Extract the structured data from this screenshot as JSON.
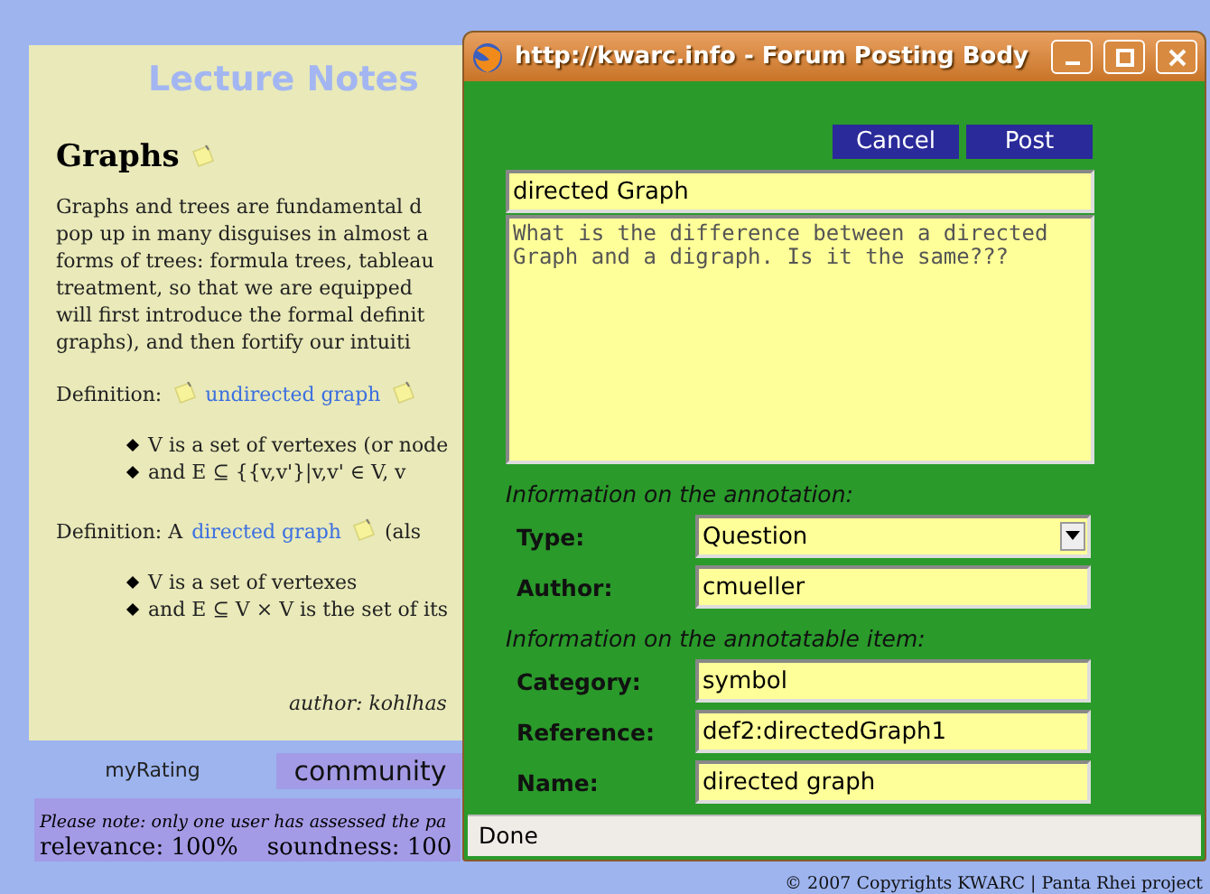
{
  "lecture": {
    "heading": "Lecture Notes",
    "section_title": "Graphs",
    "paragraph_lines": [
      "Graphs and trees are fundamental d",
      "pop up in many disguises in almost a",
      "forms of trees: formula trees, tableau",
      "treatment, so that we are equipped",
      "will first introduce the formal definit",
      "graphs), and then fortify our intuiti"
    ],
    "definitions": [
      {
        "parts": [
          {
            "kind": "text",
            "text": "Definition:"
          },
          {
            "kind": "note"
          },
          {
            "kind": "link",
            "text": "undirected graph"
          },
          {
            "kind": "note"
          }
        ],
        "bullets": [
          "V is a set of vertexes (or node",
          "and E ⊆ {{v,v'}|v,v' ∈ V, v"
        ]
      },
      {
        "parts": [
          {
            "kind": "text",
            "text": "Definition: A"
          },
          {
            "kind": "link",
            "text": "directed graph"
          },
          {
            "kind": "note"
          },
          {
            "kind": "text",
            "text": "(als"
          }
        ],
        "bullets": [
          "V is a set of vertexes",
          "and E ⊆ V × V is the set of its"
        ]
      }
    ],
    "author": "author: kohlhas"
  },
  "rating": {
    "tabs": [
      {
        "label": "myRating",
        "selected": false
      },
      {
        "label": "community",
        "selected": true
      }
    ],
    "note": "Please note: only one user has assessed the pa",
    "scores": [
      "relevance: 100%",
      "soundness: 100"
    ]
  },
  "footer": "© 2007 Copyrights KWARC | Panta Rhei project",
  "popup": {
    "title": "http://kwarc.info - Forum Posting Body",
    "buttons": [
      "Cancel",
      "Post"
    ],
    "subject": "directed Graph",
    "body": "What is the difference between a directed Graph and a digraph. Is it the same???",
    "sections": [
      {
        "heading": "Information on the annotation:",
        "fields": [
          {
            "label": "Type:",
            "kind": "select",
            "value": "Question"
          },
          {
            "label": "Author:",
            "kind": "text",
            "value": "cmueller"
          }
        ]
      },
      {
        "heading": "Information on the annotatable item:",
        "fields": [
          {
            "label": "Category:",
            "kind": "text",
            "value": "symbol"
          },
          {
            "label": "Reference:",
            "kind": "text",
            "value": "def2:directedGraph1"
          },
          {
            "label": "Name:",
            "kind": "text",
            "value": "directed graph"
          }
        ]
      }
    ],
    "status": "Done"
  }
}
